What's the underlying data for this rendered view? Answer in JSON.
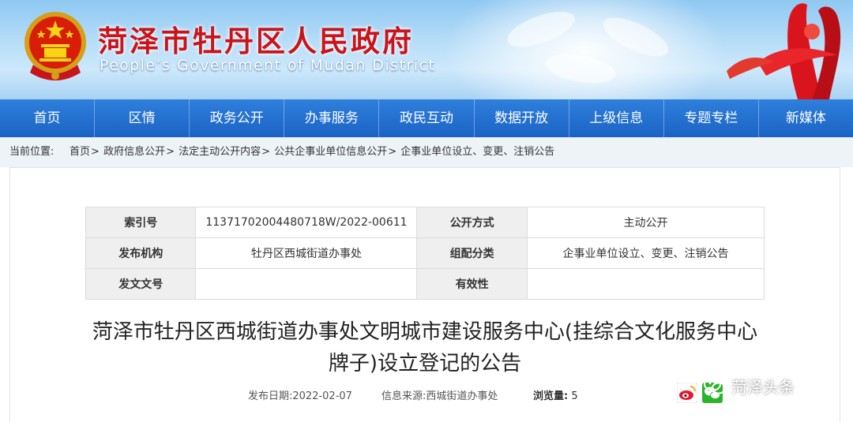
{
  "header": {
    "title": "菏泽市牡丹区人民政府",
    "subtitle": "People’s Government of Mudan District"
  },
  "nav": {
    "items": [
      {
        "label": "首页"
      },
      {
        "label": "区情"
      },
      {
        "label": "政务公开"
      },
      {
        "label": "办事服务"
      },
      {
        "label": "政民互动"
      },
      {
        "label": "数据开放"
      },
      {
        "label": "上级信息"
      },
      {
        "label": "专题专栏"
      },
      {
        "label": "新媒体"
      }
    ]
  },
  "breadcrumb": {
    "label": "当前位置:",
    "items": [
      "首页",
      "政府信息公开",
      "法定主动公开内容",
      "公共企事业单位信息公开",
      "企事业单位设立、变更、注销公告"
    ],
    "separator": ">"
  },
  "meta": {
    "index_label": "索引号",
    "index_value": "11371702004480718W/2022-00611",
    "method_label": "公开方式",
    "method_value": "主动公开",
    "publisher_label": "发布机构",
    "publisher_value": "牡丹区西城街道办事处",
    "category_label": "组配分类",
    "category_value": "企事业单位设立、变更、注销公告",
    "docno_label": "发文文号",
    "docno_value": "",
    "validity_label": "有效性",
    "validity_value": ""
  },
  "document": {
    "title_line1": "菏泽市牡丹区西城街道办事处文明城市建设服务中心(挂综合文化服务中心",
    "title_line2": "牌子)设立登记的公告",
    "date_label": "发布日期:",
    "date_value": "2022-02-07",
    "source_label": "信息来源:",
    "source_value": "西城街道办事处",
    "views_label": "浏览量:",
    "views_value": "5"
  },
  "watermark": {
    "text": "菏泽头条"
  },
  "colors": {
    "brand_red": "#c8141a",
    "nav_blue": "#1a63c4",
    "banner_blue": "#8fc8f2"
  },
  "icons": {
    "emblem": "national-emblem",
    "weibo": "weibo-share-icon",
    "wechat": "wechat-share-icon",
    "watermark": "wechat-watermark-icon"
  }
}
